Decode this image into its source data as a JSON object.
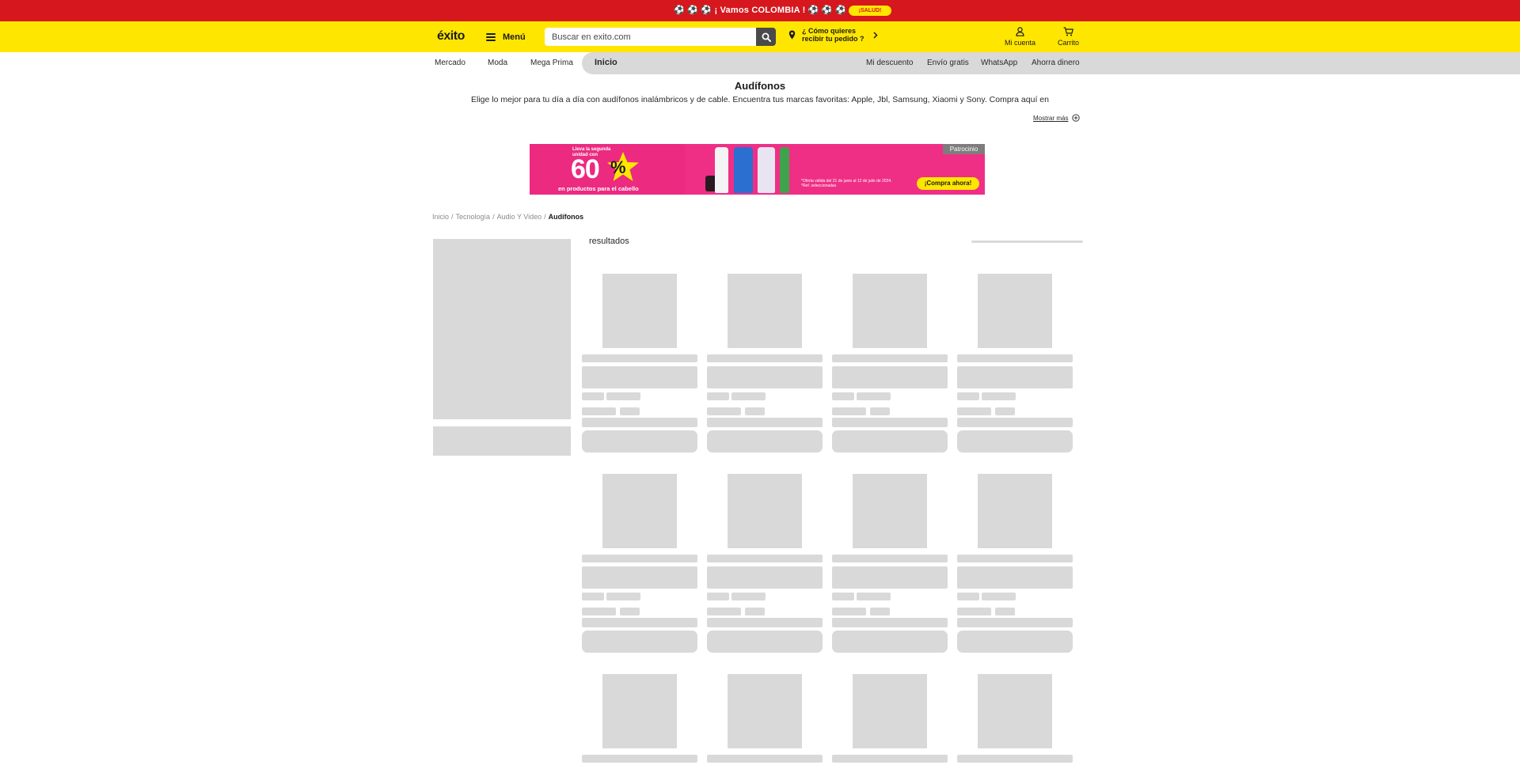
{
  "promo_bar": {
    "text": "⚽ ⚽ ⚽ ¡ Vamos COLOMBIA ! ⚽ ⚽ ⚽",
    "badge": "¡SALUD!",
    "bg_color": "#d6171d"
  },
  "header": {
    "logo": "éxito",
    "menu_label": "Menú",
    "search_placeholder": "Buscar en exito.com",
    "location_line1": "¿ Cómo quieres",
    "location_line2": "recibir tu pedido ?",
    "account_label": "Mi cuenta",
    "cart_label": "Carrito",
    "bg_color": "#ffe600"
  },
  "nav": {
    "left_items": [
      "Mercado",
      "Moda",
      "Mega Prima"
    ],
    "active_item": "Inicio",
    "right_items": [
      "Mi descuento",
      "Envío gratis",
      "WhatsApp",
      "Ahorra dinero"
    ]
  },
  "category": {
    "title": "Audífonos",
    "description": "Elige lo mejor para tu día a día con audífonos inalámbricos y de cable. Encuentra tus marcas favoritas: Apple, Jbl, Samsung, Xiaomi y Sony. Compra aquí en",
    "show_more": "Mostrar más"
  },
  "banner": {
    "small_text": "Lleva la segunda unidad con",
    "percent": "60",
    "percent_sign": "%",
    "subtitle": "en productos para el cabello",
    "fine_print": "*Oferta válida del 21 de junio al 12 de julio de 2024. *Ref. seleccionadas",
    "cta": "¡Compra ahora!",
    "tag": "Patrocinio",
    "bg_color": "#ef2f86"
  },
  "breadcrumb": {
    "items": [
      "Inicio",
      "Tecnología",
      "Audio Y Video"
    ],
    "current": "Audífonos",
    "separator": "/"
  },
  "results": {
    "label": "resultados"
  },
  "icons": {
    "menu": "hamburger-icon",
    "search": "search-icon",
    "location": "location-pin-icon",
    "chevron": "chevron-right-icon",
    "account": "user-icon",
    "cart": "cart-icon",
    "show_more": "plus-circle-icon"
  }
}
